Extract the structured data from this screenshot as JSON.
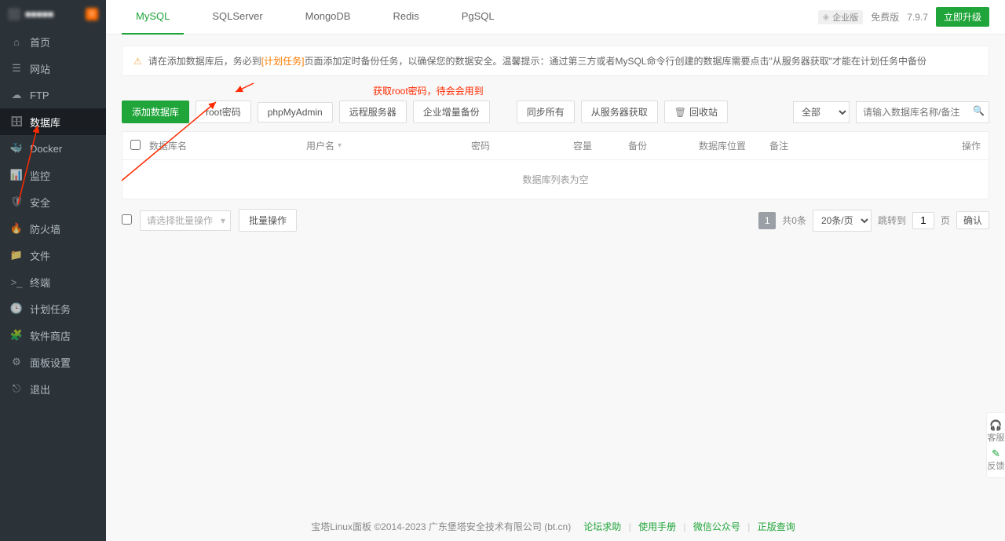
{
  "sidebar": {
    "badge": "0",
    "items": [
      {
        "icon": "home-icon",
        "label": "首页"
      },
      {
        "icon": "globe-icon",
        "label": "网站"
      },
      {
        "icon": "cloud-icon",
        "label": "FTP"
      },
      {
        "icon": "database-icon",
        "label": "数据库",
        "active": true
      },
      {
        "icon": "docker-icon",
        "label": "Docker"
      },
      {
        "icon": "monitor-icon",
        "label": "监控"
      },
      {
        "icon": "shield-icon",
        "label": "安全"
      },
      {
        "icon": "firewall-icon",
        "label": "防火墙"
      },
      {
        "icon": "folder-icon",
        "label": "文件"
      },
      {
        "icon": "terminal-icon",
        "label": "终端"
      },
      {
        "icon": "clock-icon",
        "label": "计划任务"
      },
      {
        "icon": "store-icon",
        "label": "软件商店"
      },
      {
        "icon": "settings-icon",
        "label": "面板设置"
      },
      {
        "icon": "exit-icon",
        "label": "退出"
      }
    ]
  },
  "header": {
    "tabs": [
      "MySQL",
      "SQLServer",
      "MongoDB",
      "Redis",
      "PgSQL"
    ],
    "active_tab": "MySQL",
    "ent_label": "企业版",
    "free_label": "免费版",
    "version": "7.9.7",
    "upgrade": "立即升级"
  },
  "notice": {
    "pre": "请在添加数据库后，务必到",
    "link": "[计划任务]",
    "post": "页面添加定时备份任务，以确保您的数据安全。温馨提示：通过第三方或者MySQL命令行创建的数据库需要点击\"从服务器获取\"才能在计划任务中备份"
  },
  "annotation": "获取root密码，待会会用到",
  "toolbar": {
    "add": "添加数据库",
    "root": "root密码",
    "pma": "phpMyAdmin",
    "remote": "远程服务器",
    "incr": "企业增量备份",
    "sync": "同步所有",
    "fetch": "从服务器获取",
    "recycle": "回收站",
    "filter": "全部",
    "search_ph": "请输入数据库名称/备注"
  },
  "table": {
    "headers": {
      "name": "数据库名",
      "user": "用户名",
      "pwd": "密码",
      "cap": "容量",
      "bak": "备份",
      "loc": "数据库位置",
      "remark": "备注",
      "op": "操作"
    },
    "empty": "数据库列表为空"
  },
  "batch": {
    "placeholder": "请选择批量操作",
    "action": "批量操作"
  },
  "pager": {
    "page": "1",
    "total": "共0条",
    "size_label": "20条/页",
    "jump_label": "跳转到",
    "jump_val": "1",
    "page_unit": "页",
    "confirm": "确认"
  },
  "footer": {
    "text": "宝塔Linux面板 ©2014-2023 广东堡塔安全技术有限公司 (bt.cn)",
    "links": [
      "论坛求助",
      "使用手册",
      "微信公众号",
      "正版查询"
    ]
  },
  "float": {
    "cs": "客服",
    "fb": "反馈"
  },
  "icons": {
    "home-icon": "⌂",
    "globe-icon": "☰",
    "cloud-icon": "☁",
    "database-icon": "🗄",
    "docker-icon": "🐳",
    "monitor-icon": "📊",
    "shield-icon": "🛡",
    "firewall-icon": "🔥",
    "folder-icon": "📁",
    "terminal-icon": ">_",
    "clock-icon": "🕒",
    "store-icon": "🧩",
    "settings-icon": "⚙",
    "exit-icon": "⎋"
  }
}
